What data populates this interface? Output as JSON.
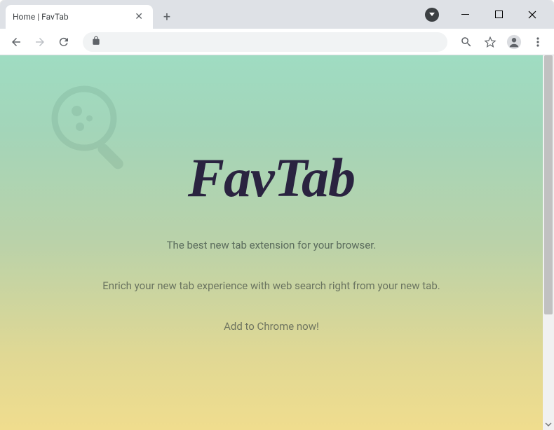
{
  "tab": {
    "title": "Home | FavTab"
  },
  "page": {
    "logo": "FavTab",
    "tagline": "The best new tab extension for your browser.",
    "subline": "Enrich your new tab experience with web search right from your new tab.",
    "cta": "Add to Chrome now!"
  }
}
